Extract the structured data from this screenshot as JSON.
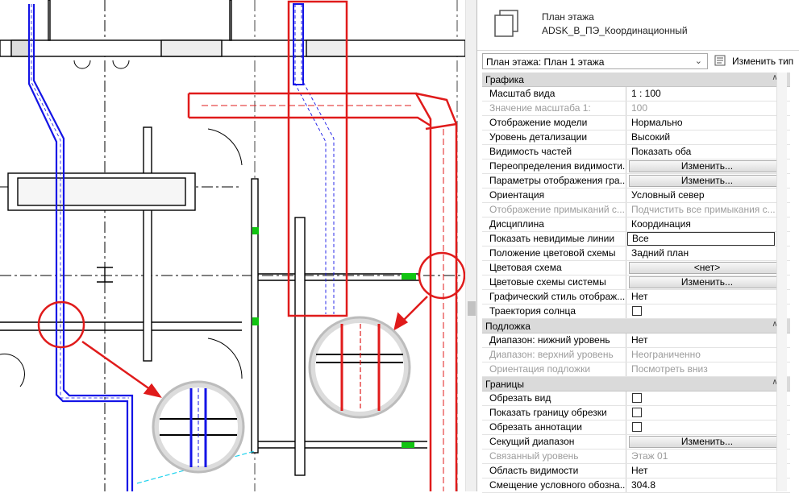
{
  "type_header": {
    "family": "План этажа",
    "type_name": "ADSK_В_ПЭ_Координационный",
    "icon": "floor-plan-type-icon"
  },
  "type_selector": {
    "value": "План этажа: План 1 этажа"
  },
  "edit_type": {
    "label": "Изменить тип",
    "icon": "edit-type-icon"
  },
  "groups": {
    "graphics": "Графика",
    "underlay": "Подложка",
    "extents": "Границы"
  },
  "properties": {
    "graphics": [
      {
        "key": "Масштаб вида",
        "value": "1 : 100"
      },
      {
        "key": "Значение масштаба    1:",
        "value": "100"
      },
      {
        "key": "Отображение модели",
        "value": "Нормально"
      },
      {
        "key": "Уровень детализации",
        "value": "Высокий"
      },
      {
        "key": "Видимость частей",
        "value": "Показать оба"
      },
      {
        "key": "Переопределения видимости...",
        "value": "Изменить..."
      },
      {
        "key": "Параметры отображения гра...",
        "value": "Изменить..."
      },
      {
        "key": "Ориентация",
        "value": "Условный север"
      },
      {
        "key": "Отображение примыканий с...",
        "value": "Подчистить все примыкания с..."
      },
      {
        "key": "Дисциплина",
        "value": "Координация"
      },
      {
        "key": "Показать невидимые линии",
        "value": "Все"
      },
      {
        "key": "Положение цветовой схемы",
        "value": "Задний план"
      },
      {
        "key": "Цветовая схема",
        "value": "<нет>"
      },
      {
        "key": "Цветовые схемы системы",
        "value": "Изменить..."
      },
      {
        "key": "Графический стиль отображ...",
        "value": "Нет"
      },
      {
        "key": "Траектория солнца",
        "value": ""
      }
    ],
    "underlay": [
      {
        "key": "Диапазон: нижний уровень",
        "value": "Нет"
      },
      {
        "key": "Диапазон: верхний уровень",
        "value": "Неограниченно"
      },
      {
        "key": "Ориентация подложки",
        "value": "Посмотреть вниз"
      }
    ],
    "extents": [
      {
        "key": "Обрезать вид",
        "value": ""
      },
      {
        "key": "Показать границу обрезки",
        "value": ""
      },
      {
        "key": "Обрезать аннотации",
        "value": ""
      },
      {
        "key": "Секущий диапазон",
        "value": "Изменить..."
      },
      {
        "key": "Связанный уровень",
        "value": "Этаж 01"
      },
      {
        "key": "Область видимости",
        "value": "Нет"
      },
      {
        "key": "Смещение условного обозна...",
        "value": "304.8"
      }
    ]
  },
  "colors": {
    "duct_blue": "#1414e6",
    "highlight_red": "#e01b1b",
    "wall_black": "#000000",
    "door_green": "#11c411",
    "group_header": "#dadada"
  }
}
